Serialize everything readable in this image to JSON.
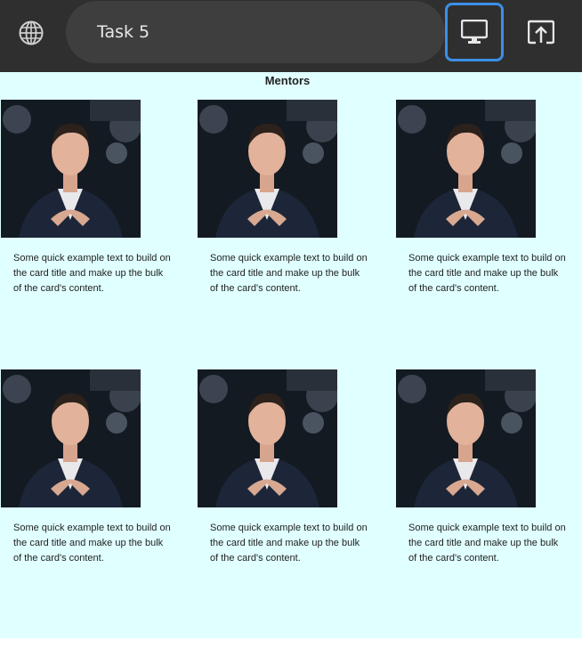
{
  "toolbar": {
    "task_title": "Task 5",
    "globe_icon": "globe-icon",
    "desktop_icon": "desktop-monitor-icon",
    "open_icon": "open-in-new-window-icon",
    "active_accent": "#3b8fe8"
  },
  "page": {
    "section_title": "Mentors",
    "background": "#e0ffff",
    "cards": [
      {
        "text": "Some quick example text to build on the card title and make up the bulk of the card's content."
      },
      {
        "text": "Some quick example text to build on the card title and make up the bulk of the card's content."
      },
      {
        "text": "Some quick example text to build on the card title and make up the bulk of the card's content."
      },
      {
        "text": "Some quick example text to build on the card title and make up the bulk of the card's content."
      },
      {
        "text": "Some quick example text to build on the card title and make up the bulk of the card's content."
      },
      {
        "text": "Some quick example text to build on the card title and make up the bulk of the card's content."
      }
    ]
  }
}
